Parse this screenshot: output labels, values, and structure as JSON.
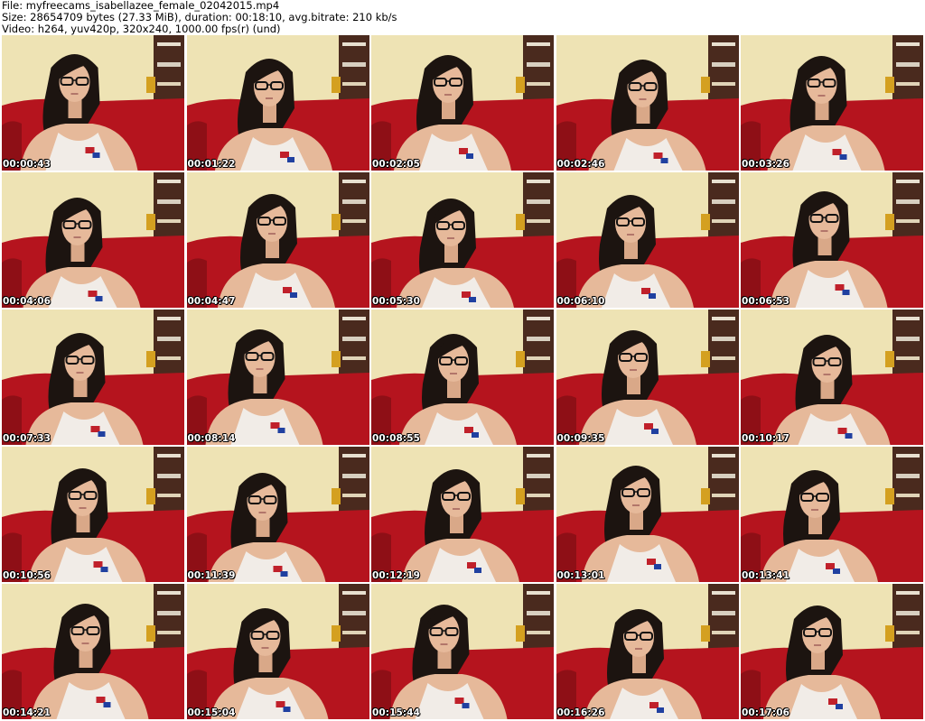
{
  "header": {
    "file_line": "File: myfreecams_isabellazee_female_02042015.mp4",
    "size_line": "Size: 28654709 bytes (27.33 MiB), duration: 00:18:10, avg.bitrate: 210 kb/s",
    "video_line": "Video: h264, yuv420p, 320x240, 1000.00 fps(r) (und)"
  },
  "colors": {
    "wall": "#eee3b4",
    "couch": "#b5141e",
    "hair": "#1c1410",
    "skin": "#e6b99a",
    "shirt": "#f1ece7",
    "shelf": "#4a2a1e"
  },
  "thumbnails": [
    {
      "timestamp": "00:00:43"
    },
    {
      "timestamp": "00:01:22"
    },
    {
      "timestamp": "00:02:05"
    },
    {
      "timestamp": "00:02:46"
    },
    {
      "timestamp": "00:03:26"
    },
    {
      "timestamp": "00:04:06"
    },
    {
      "timestamp": "00:04:47"
    },
    {
      "timestamp": "00:05:30"
    },
    {
      "timestamp": "00:06:10"
    },
    {
      "timestamp": "00:06:53"
    },
    {
      "timestamp": "00:07:33"
    },
    {
      "timestamp": "00:08:14"
    },
    {
      "timestamp": "00:08:55"
    },
    {
      "timestamp": "00:09:35"
    },
    {
      "timestamp": "00:10:17"
    },
    {
      "timestamp": "00:10:56"
    },
    {
      "timestamp": "00:11:39"
    },
    {
      "timestamp": "00:12:19"
    },
    {
      "timestamp": "00:13:01"
    },
    {
      "timestamp": "00:13:41"
    },
    {
      "timestamp": "00:14:21"
    },
    {
      "timestamp": "00:15:04"
    },
    {
      "timestamp": "00:15:44"
    },
    {
      "timestamp": "00:16:26"
    },
    {
      "timestamp": "00:17:06"
    }
  ]
}
